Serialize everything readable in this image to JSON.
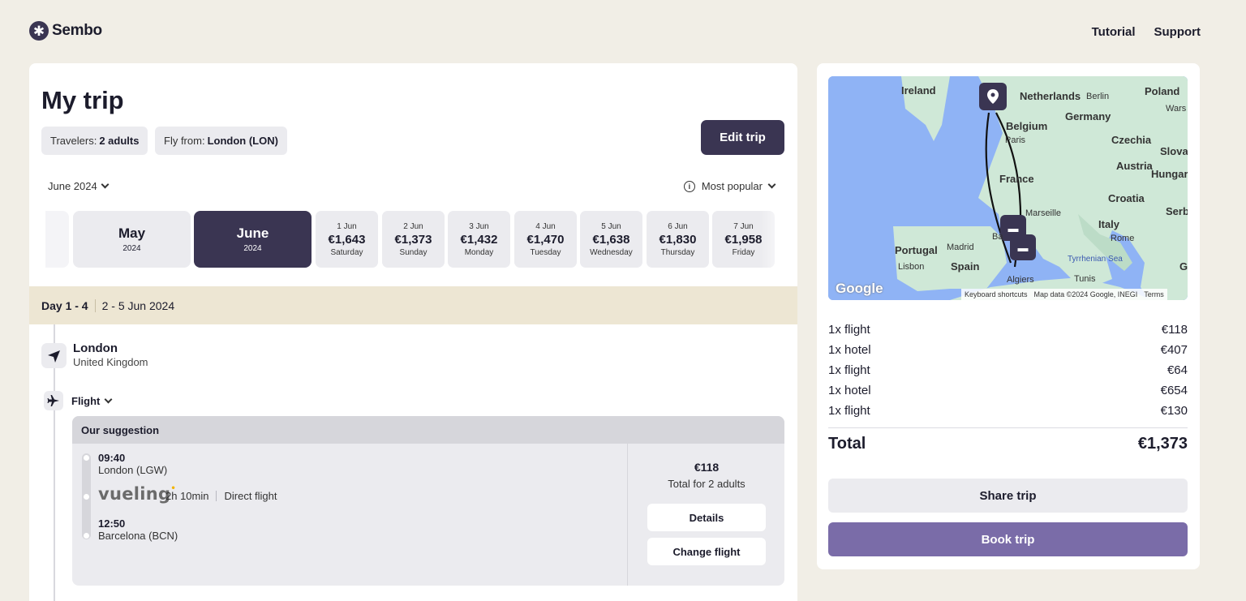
{
  "header": {
    "logo": "Sembo",
    "nav": [
      "Tutorial",
      "Support"
    ]
  },
  "trip": {
    "title": "My trip",
    "travelers_label": "Travelers:",
    "travelers_value": "2 adults",
    "fly_from_label": "Fly from:",
    "fly_from_value": "London (LON)",
    "edit_button": "Edit trip",
    "month_selector": "June 2024",
    "sort_selector": "Most popular"
  },
  "months": [
    {
      "month": "May",
      "year": "2024",
      "selected": false
    },
    {
      "month": "June",
      "year": "2024",
      "selected": true
    }
  ],
  "dates": [
    {
      "date": "1 Jun",
      "price": "€1,643",
      "weekday": "Saturday"
    },
    {
      "date": "2 Jun",
      "price": "€1,373",
      "weekday": "Sunday"
    },
    {
      "date": "3 Jun",
      "price": "€1,432",
      "weekday": "Monday"
    },
    {
      "date": "4 Jun",
      "price": "€1,470",
      "weekday": "Tuesday"
    },
    {
      "date": "5 Jun",
      "price": "€1,638",
      "weekday": "Wednesday"
    },
    {
      "date": "6 Jun",
      "price": "€1,830",
      "weekday": "Thursday"
    },
    {
      "date": "7 Jun",
      "price": "€1,958",
      "weekday": "Friday"
    }
  ],
  "day_band": {
    "days": "Day 1 - 4",
    "range": "2 - 5 Jun 2024"
  },
  "origin": {
    "city": "London",
    "country": "United Kingdom"
  },
  "flight_section": {
    "label": "Flight",
    "suggestion_header": "Our suggestion",
    "departure_time": "09:40",
    "departure_airport": "London (LGW)",
    "airline": "vueling",
    "duration": "2h 10min",
    "stops": "Direct flight",
    "arrival_time": "12:50",
    "arrival_airport": "Barcelona (BCN)",
    "price": "€118",
    "price_note": "Total for 2 adults",
    "details_button": "Details",
    "change_button": "Change flight"
  },
  "map": {
    "labels": [
      "Ireland",
      "Netherlands",
      "Berlin",
      "Poland",
      "Wars",
      "Germany",
      "Belgium",
      "Paris",
      "Czechia",
      "Slovak",
      "Austria",
      "Hungar",
      "France",
      "Croatia",
      "Serb",
      "Marseille",
      "Italy",
      "Rome",
      "Portugal",
      "Madrid",
      "Spain",
      "Lisbon",
      "Ba",
      "Tyrrhenian Sea",
      "G",
      "Algiers",
      "Tunis"
    ],
    "google": "Google",
    "attribution": [
      "Keyboard shortcuts",
      "Map data ©2024 Google, INEGI",
      "Terms"
    ]
  },
  "summary": {
    "lines": [
      {
        "label": "1x flight",
        "price": "€118"
      },
      {
        "label": "1x hotel",
        "price": "€407"
      },
      {
        "label": "1x flight",
        "price": "€64"
      },
      {
        "label": "1x hotel",
        "price": "€654"
      },
      {
        "label": "1x flight",
        "price": "€130"
      }
    ],
    "total_label": "Total",
    "total_value": "€1,373",
    "share_button": "Share trip",
    "book_button": "Book trip"
  },
  "colors": {
    "background": "#f1eee6",
    "primary_dark": "#3a3552",
    "book_purple": "#7a6ca8",
    "day_band": "#ede6d3",
    "chip_gray": "#ebebef",
    "map_sea": "#8fb3f5",
    "map_land": "#cfe8d7"
  },
  "icons": {
    "logo": "asterisk-icon",
    "location": "navigation-arrow-icon",
    "flight": "airplane-icon",
    "info": "info-icon",
    "chevron": "chevron-down-icon",
    "map_marker": "location-pin-icon",
    "hotel": "bed-icon"
  }
}
